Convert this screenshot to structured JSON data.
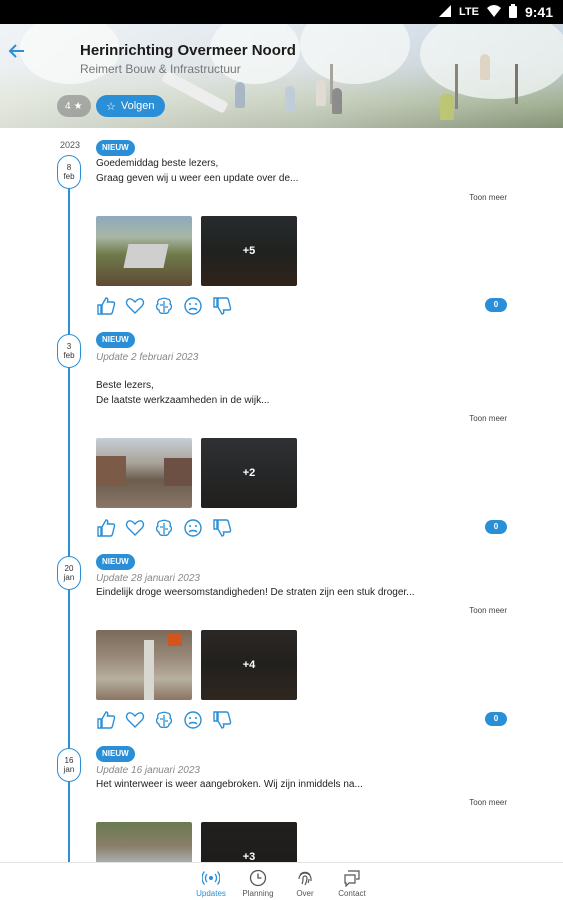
{
  "status_bar": {
    "network": "LTE",
    "time": "9:41"
  },
  "header": {
    "title": "Herinrichting Overmeer Noord",
    "subtitle": "Reimert Bouw & Infrastructuur",
    "followers_count": "4",
    "follow_label": "Volgen"
  },
  "timeline": {
    "year": "2023"
  },
  "posts": [
    {
      "day": "8",
      "month": "feb",
      "badge": "NIEUW",
      "updated": "",
      "line1": "Goedemiddag beste lezers,",
      "line2": "Graag geven wij u weer een update over de...",
      "toon_meer": "Toon meer",
      "photo_extra": "+5",
      "comments": "0"
    },
    {
      "day": "3",
      "month": "feb",
      "badge": "NIEUW",
      "updated": "Update 2 februari 2023",
      "line1": "Beste lezers,",
      "line2": "De laatste werkzaamheden in de wijk...",
      "toon_meer": "Toon meer",
      "photo_extra": "+2",
      "comments": "0"
    },
    {
      "day": "20",
      "month": "jan",
      "badge": "NIEUW",
      "updated": "Update 28 januari 2023",
      "line1": "Eindelijk droge weersomstandigheden! De straten zijn een stuk droger...",
      "line2": "",
      "toon_meer": "Toon meer",
      "photo_extra": "+4",
      "comments": "0"
    },
    {
      "day": "16",
      "month": "jan",
      "badge": "NIEUW",
      "updated": "Update 16 januari 2023",
      "line1": "Het winterweer is weer aangebroken. Wij zijn inmiddels na...",
      "line2": "",
      "toon_meer": "Toon meer",
      "photo_extra": "+3",
      "comments": ""
    }
  ],
  "tabs": [
    {
      "label": "Updates",
      "icon": "broadcast-icon",
      "active": true
    },
    {
      "label": "Planning",
      "icon": "clock-icon",
      "active": false
    },
    {
      "label": "Over",
      "icon": "fingerprint-icon",
      "active": false
    },
    {
      "label": "Contact",
      "icon": "chat-icon",
      "active": false
    }
  ],
  "colors": {
    "accent": "#2a8fd6"
  }
}
